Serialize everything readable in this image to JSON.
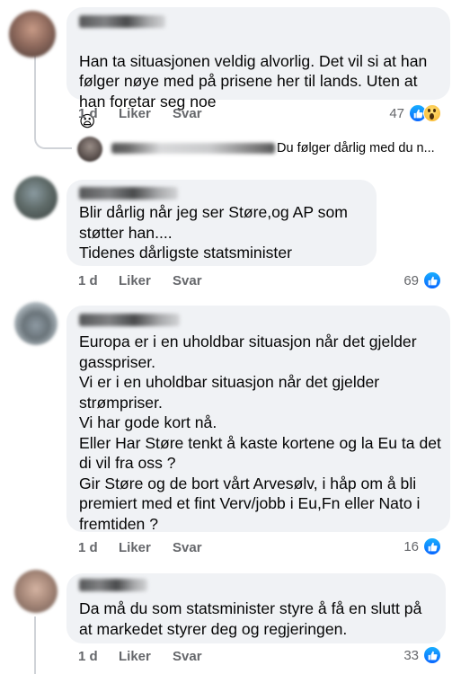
{
  "actions": {
    "time": "1 d",
    "like": "Liker",
    "reply": "Svar"
  },
  "colors": {
    "bubble": "#f0f2f5",
    "text": "#050505",
    "meta": "#65676b",
    "like_blue": "#0866ff"
  },
  "comments": [
    {
      "text": "Han ta situasjonen veldig alvorlig. Det vil si at han følger nøye med på prisene her til lands. Uten at han foretar seg noe",
      "emoji": "😦",
      "reaction_count": "47",
      "reactions": [
        "like-icon",
        "wow-icon"
      ],
      "reply_preview": "Du følger dårlig med du n..."
    },
    {
      "text": "Blir dårlig når jeg ser Støre,og AP som støtter han....\nTidenes dårligste statsminister",
      "reaction_count": "69",
      "reactions": [
        "like-icon"
      ]
    },
    {
      "text": "Europa er i en uholdbar situasjon når det gjelder gasspriser.\nVi er i en uholdbar situasjon når det gjelder strømpriser.\nVi har gode kort nå.\nEller Har Støre tenkt å kaste kortene og la Eu ta det di vil fra oss ?\nGir Støre og de bort vårt Arvesølv, i håp om å bli premiert med et fint Verv/jobb i Eu,Fn eller Nato i fremtiden ?",
      "reaction_count": "16",
      "reactions": [
        "like-icon"
      ]
    },
    {
      "text": "Da må du som statsminister styre å få en slutt på at markedet styrer deg og regjeringen.",
      "reaction_count": "33",
      "reactions": [
        "like-icon"
      ]
    }
  ]
}
